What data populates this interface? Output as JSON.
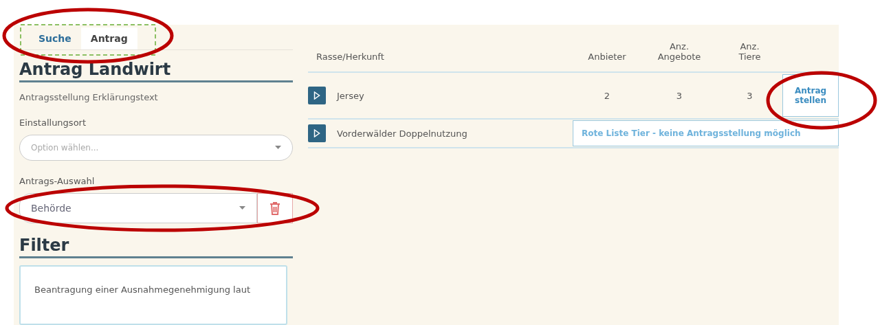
{
  "tabs": [
    {
      "label": "Suche",
      "selected": false
    },
    {
      "label": "Antrag",
      "selected": true
    }
  ],
  "form": {
    "title": "Antrag Landwirt",
    "description": "Antragsstellung Erklärungstext",
    "fields": [
      {
        "label": "Einstallungsort",
        "placeholder": "Option wählen...",
        "deletable": false
      },
      {
        "label": "Antrags-Auswahl",
        "value": "Behörde",
        "deletable": true
      }
    ]
  },
  "filter": {
    "title": "Filter",
    "text": "Beantragung einer Ausnahmegenehmigung laut"
  },
  "table": {
    "columns": [
      {
        "label": "Rasse/Herkunft"
      },
      {
        "label": "Anbieter"
      },
      {
        "label": "Anz. Angebote"
      },
      {
        "label": "Anz. Tiere"
      }
    ],
    "rows": [
      {
        "kind": "offer",
        "breed": "Jersey",
        "providers": "2",
        "offers": "3",
        "animals": "3",
        "action": "Antrag stellen"
      },
      {
        "kind": "notice",
        "breed": "Vorderwälder Doppelnutzung",
        "notice": "Rote Liste Tier - keine Antragsstellung möglich"
      }
    ]
  }
}
